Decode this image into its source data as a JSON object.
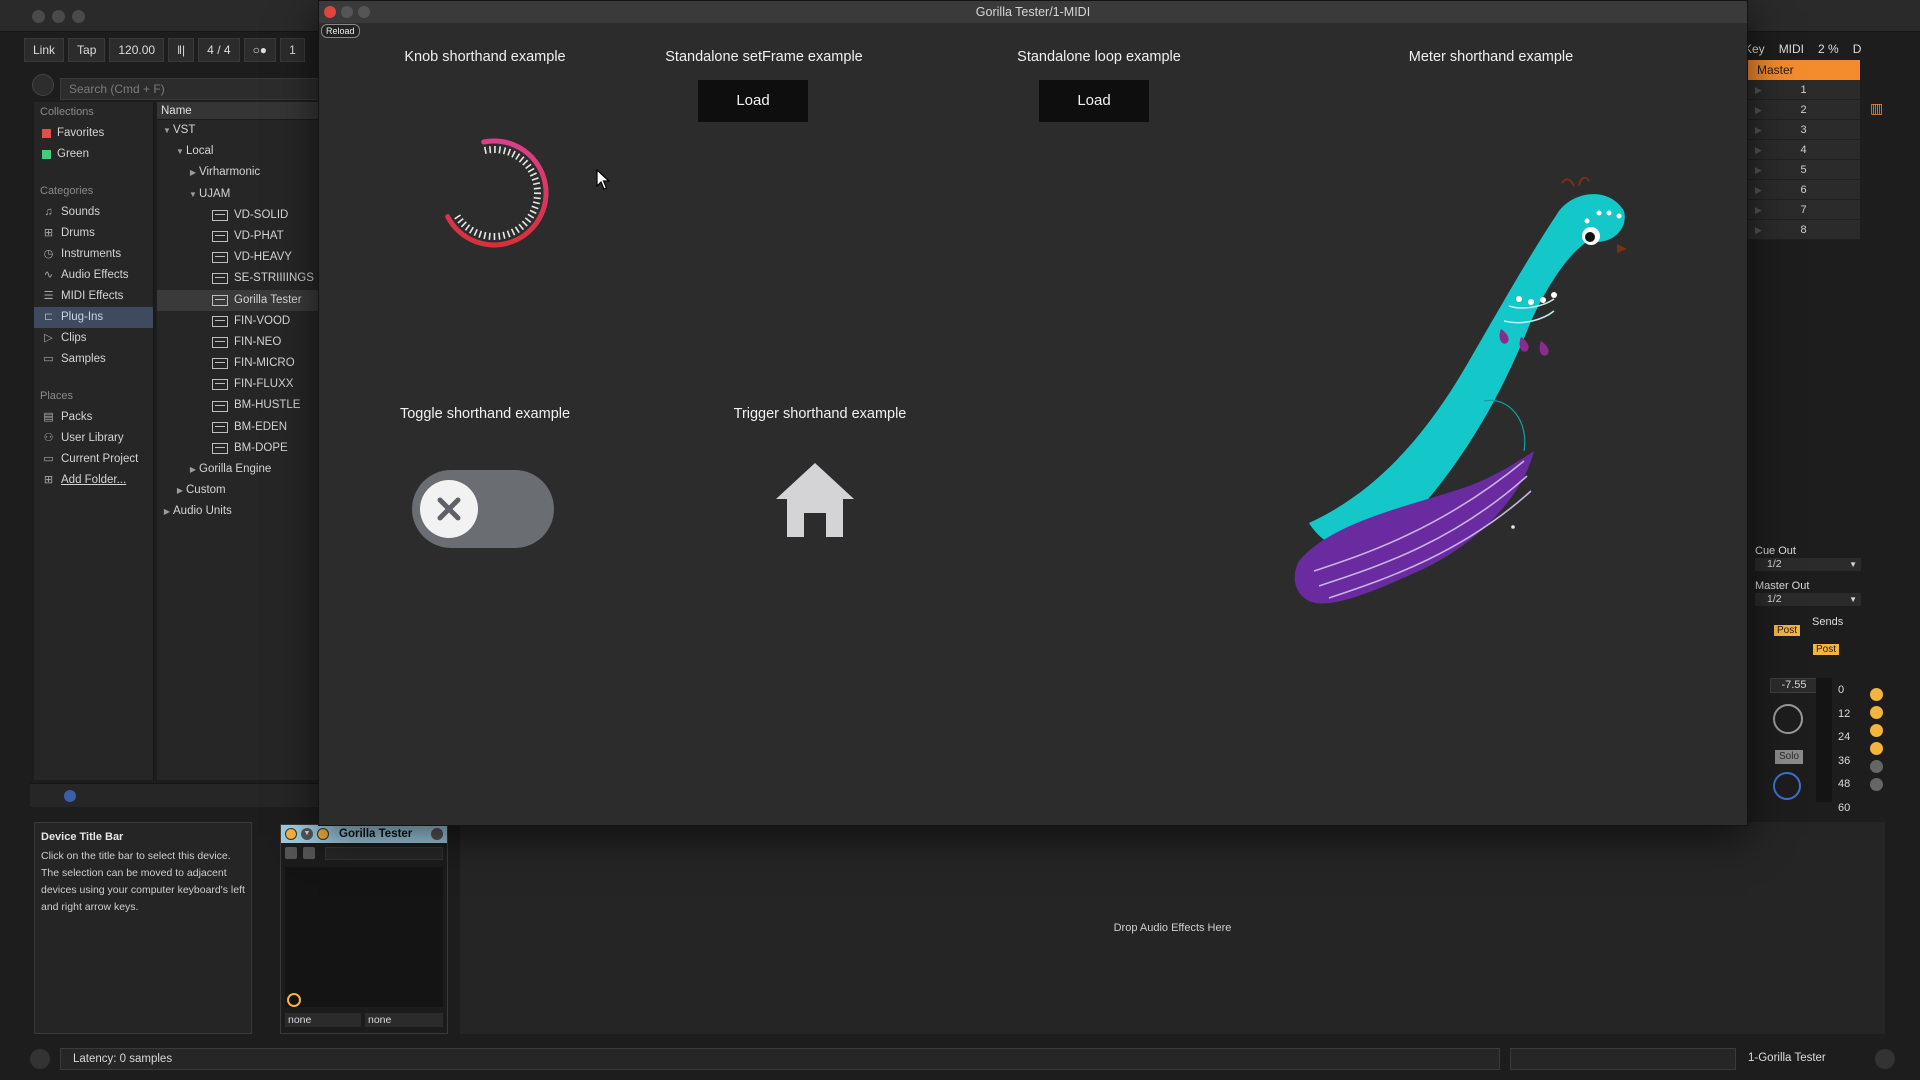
{
  "plugin_window": {
    "title": "Gorilla Tester/1-MIDI",
    "reload_label": "Reload",
    "examples": {
      "knob": "Knob shorthand example",
      "setframe": "Standalone setFrame example",
      "loop": "Standalone loop example",
      "meter": "Meter shorthand example",
      "toggle": "Toggle shorthand example",
      "trigger": "Trigger shorthand  example"
    },
    "load_label": "Load",
    "knob_value": 0.5,
    "toggle_state": "off"
  },
  "control_bar": {
    "link": "Link",
    "tap": "Tap",
    "tempo": "120.00",
    "signature_num": "4",
    "signature_sep": "/",
    "signature_den": "4",
    "bar": "1",
    "key": "Key",
    "midi": "MIDI",
    "cpu": "2 %",
    "d": "D"
  },
  "browser": {
    "search_placeholder": "Search (Cmd + F)",
    "collections_header": "Collections",
    "collections": [
      {
        "label": "Favorites",
        "color": "#e24d4d"
      },
      {
        "label": "Green",
        "color": "#3fcf7a"
      }
    ],
    "categories_header": "Categories",
    "categories": [
      "Sounds",
      "Drums",
      "Instruments",
      "Audio Effects",
      "MIDI Effects",
      "Plug-Ins",
      "Clips",
      "Samples"
    ],
    "places_header": "Places",
    "places": [
      "Packs",
      "User Library",
      "Current Project",
      "Add Folder..."
    ],
    "name_header": "Name",
    "tree": [
      {
        "label": "VST",
        "level": 0,
        "arrow": "▼",
        "plug": false
      },
      {
        "label": "Local",
        "level": 1,
        "arrow": "▼",
        "plug": false
      },
      {
        "label": "Virharmonic",
        "level": 2,
        "arrow": "▶",
        "plug": false
      },
      {
        "label": "UJAM",
        "level": 2,
        "arrow": "▼",
        "plug": false
      },
      {
        "label": "VD-SOLID",
        "level": 3,
        "arrow": "",
        "plug": true
      },
      {
        "label": "VD-PHAT",
        "level": 3,
        "arrow": "",
        "plug": true
      },
      {
        "label": "VD-HEAVY",
        "level": 3,
        "arrow": "",
        "plug": true
      },
      {
        "label": "SE-STRIIIINGS",
        "level": 3,
        "arrow": "",
        "plug": true
      },
      {
        "label": "Gorilla Tester",
        "level": 3,
        "arrow": "",
        "plug": true
      },
      {
        "label": "FIN-VOOD",
        "level": 3,
        "arrow": "",
        "plug": true
      },
      {
        "label": "FIN-NEO",
        "level": 3,
        "arrow": "",
        "plug": true
      },
      {
        "label": "FIN-MICRO",
        "level": 3,
        "arrow": "",
        "plug": true
      },
      {
        "label": "FIN-FLUXX",
        "level": 3,
        "arrow": "",
        "plug": true
      },
      {
        "label": "BM-HUSTLE",
        "level": 3,
        "arrow": "",
        "plug": true
      },
      {
        "label": "BM-EDEN",
        "level": 3,
        "arrow": "",
        "plug": true
      },
      {
        "label": "BM-DOPE",
        "level": 3,
        "arrow": "",
        "plug": true
      },
      {
        "label": "Gorilla Engine",
        "level": 2,
        "arrow": "▶",
        "plug": false
      },
      {
        "label": "Custom",
        "level": 1,
        "arrow": "▶",
        "plug": false
      },
      {
        "label": "Audio Units",
        "level": 0,
        "arrow": "▶",
        "plug": false
      }
    ]
  },
  "mixer": {
    "master": "Master",
    "slots": [
      "1",
      "2",
      "3",
      "4",
      "5",
      "6",
      "7",
      "8"
    ],
    "cue_out": "Cue Out",
    "cue_value": "1/2",
    "master_out": "Master Out",
    "master_value": "1/2",
    "sends": "Sends",
    "post1": "Post",
    "post2": "Post",
    "volume": "-7.55",
    "solo": "Solo",
    "scale": [
      "0",
      "12",
      "24",
      "36",
      "48",
      "60"
    ]
  },
  "info_view": {
    "title": "Device Title Bar",
    "text": "Click on the title bar to select this device. The selection can be moved to adjacent devices using your computer keyboard's left and right arrow keys."
  },
  "device": {
    "title": "Gorilla Tester",
    "param1": "none",
    "param2": "none"
  },
  "drop_zone": "Drop Audio Effects Here",
  "status": {
    "latency": "Latency: 0 samples",
    "track": "1-Gorilla Tester"
  }
}
